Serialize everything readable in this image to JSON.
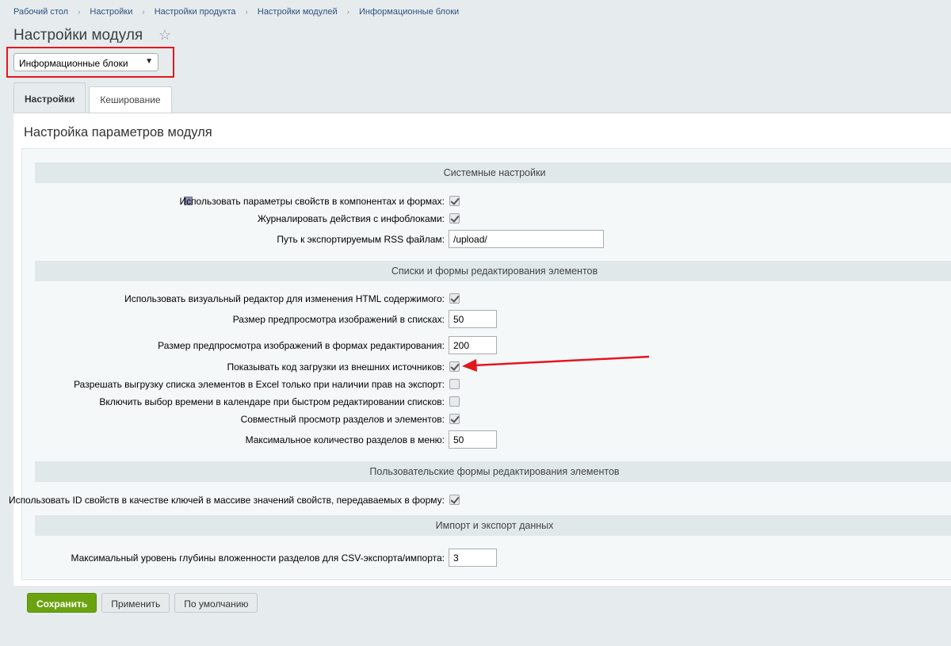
{
  "breadcrumb": [
    "Рабочий стол",
    "Настройки",
    "Настройки продукта",
    "Настройки модулей",
    "Информационные блоки"
  ],
  "page_title": "Настройки модуля",
  "module_select": {
    "value": "Информационные блоки"
  },
  "tabs": [
    "Настройки",
    "Кеширование"
  ],
  "panel_title": "Настройка параметров модуля",
  "sections": {
    "system": "Системные настройки",
    "lists": "Списки и формы редактирования элементов",
    "custom_forms": "Пользовательские формы редактирования элементов",
    "import_export": "Импорт и экспорт данных"
  },
  "settings": {
    "use_property_params": {
      "label": "Использовать параметры свойств в компонентах и формах:",
      "checked": true
    },
    "log_iblock_actions": {
      "label": "Журналировать действия с инфоблоками:",
      "checked": true
    },
    "rss_path": {
      "label": "Путь к экспортируемым RSS файлам:",
      "value": "/upload/"
    },
    "visual_editor": {
      "label": "Использовать визуальный редактор для изменения HTML содержимого:",
      "checked": true
    },
    "list_preview_size": {
      "label": "Размер предпросмотра изображений в списках:",
      "value": "50"
    },
    "form_preview_size": {
      "label": "Размер предпросмотра изображений в формах редактирования:",
      "value": "200"
    },
    "show_external_code": {
      "label": "Показывать код загрузки из внешних источников:",
      "checked": true
    },
    "excel_export_rights": {
      "label": "Разрешать выгрузку списка элементов в Excel только при наличии прав на экспорт:",
      "checked": false
    },
    "calendar_time": {
      "label": "Включить выбор времени в календаре при быстром редактировании списков:",
      "checked": false
    },
    "combined_view": {
      "label": "Совместный просмотр разделов и элементов:",
      "checked": true
    },
    "max_menu_sections": {
      "label": "Максимальное количество разделов в меню:",
      "value": "50"
    },
    "use_property_ids": {
      "label": "Использовать ID свойств в качестве ключей в массиве значений свойств, передаваемых в форму:",
      "checked": true
    },
    "csv_depth": {
      "label": "Максимальный уровень глубины вложенности разделов для CSV-экспорта/импорта:",
      "value": "3"
    }
  },
  "buttons": {
    "save": "Сохранить",
    "apply": "Применить",
    "default": "По умолчанию"
  },
  "colors": {
    "primary_button": "#6aa30f",
    "highlight": "#e3171e"
  }
}
